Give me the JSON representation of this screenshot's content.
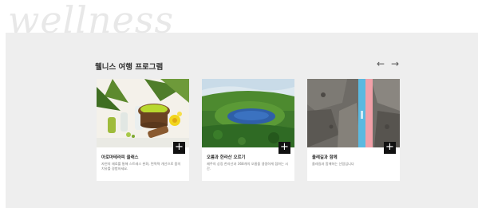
{
  "watermark": "wellness",
  "section": {
    "title": "웰니스 여행 프로그램",
    "prev_arrow": "←",
    "next_arrow": "→"
  },
  "cards": [
    {
      "title": "아로마테라피 클래스",
      "desc": "자연의 재료를 통해 스트레스 완화, 면역력 개선으로 몸의 치유를 경험하세요.",
      "plus": "+"
    },
    {
      "title": "오름과 한라산 오르기",
      "desc": "제주의 상징 한라산과 368개의 오름을 생생하게 접하는 시간.",
      "plus": "+"
    },
    {
      "title": "올레길과 함께",
      "desc": "올레길과 함께하는 산림입니다",
      "plus": "+"
    }
  ]
}
